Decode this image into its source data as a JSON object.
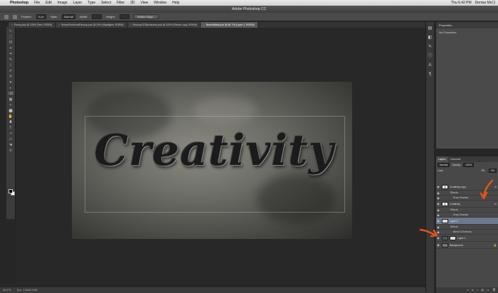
{
  "menubar": {
    "app": "Photoshop",
    "items": [
      "File",
      "Edit",
      "Image",
      "Layer",
      "Type",
      "Select",
      "Filter",
      "3D",
      "View",
      "Window",
      "Help"
    ],
    "clock": "Thu 6:42 PM",
    "user": "Denise McCl"
  },
  "window": {
    "title": "Adobe Photoshop CC"
  },
  "options": {
    "feather_label": "Feather:",
    "feather_value": "0 px",
    "style_label": "Style:",
    "style_value": "Normal",
    "width_label": "Width:",
    "height_label": "Height:",
    "refine_label": "Refine Edge..."
  },
  "tabs": [
    {
      "label": "Peony.psd @ 100% (Text, RGB/8)",
      "active": false
    },
    {
      "label": "SimpleTechnicalRecoup.psd @ 15% (Highlights, RGB/8)",
      "active": false
    },
    {
      "label": "Mockup1978photomut.psd @ 100% (Stencil copy, RGB/8)",
      "active": false
    },
    {
      "label": "BeachMetal.psd @ 66.7% (Layer 2, RGB/8)",
      "active": true
    }
  ],
  "tools": [
    "↖",
    "⬚",
    "ʘ",
    "⌖",
    "⌗",
    "✎",
    "⌇",
    "✐",
    "⚘",
    "✦",
    "◐",
    "⌫",
    "▦",
    "✧",
    "⬤",
    "✋",
    "⬮",
    "T",
    "↗",
    "▭",
    "☚",
    "⚲"
  ],
  "artwork": {
    "text": "Creativity"
  },
  "properties": {
    "title": "Properties",
    "body": "No Properties"
  },
  "layers_panel": {
    "tabs": [
      "Layers",
      "Channels"
    ],
    "blend_mode": "Normal",
    "opacity_label": "Opacity:",
    "opacity_value": "100%",
    "lock_label": "Lock:",
    "fill_label": "Fill:",
    "fill_value": "0%",
    "layers": [
      {
        "name": "Creativity copy",
        "kind": "text",
        "fx": true,
        "selected": false
      },
      {
        "name": "Effects",
        "kind": "sub"
      },
      {
        "name": "Drop Shadow",
        "kind": "sub2"
      },
      {
        "name": "Creativity",
        "kind": "text",
        "fx": true,
        "selected": false
      },
      {
        "name": "Effects",
        "kind": "sub"
      },
      {
        "name": "Drop Shadow",
        "kind": "sub2"
      },
      {
        "name": "Layer 2",
        "kind": "pixel",
        "fx": false,
        "selected": true
      },
      {
        "name": "Effects",
        "kind": "sub"
      },
      {
        "name": "Bevel & Emboss",
        "kind": "sub2"
      },
      {
        "name": "Layer 1",
        "kind": "mask",
        "fx": false,
        "selected": false
      },
      {
        "name": "Background",
        "kind": "bg",
        "fx": false,
        "selected": false
      }
    ],
    "footer_icons": [
      "∞",
      "fx",
      "◐",
      "▤",
      "▭",
      "🗑"
    ]
  },
  "status": {
    "zoom": "66.67%",
    "doc": "Doc: 1.80M/15.9M"
  },
  "colors": {
    "accent_arrow": "#e0541c",
    "selection": "#6b7a8f"
  }
}
